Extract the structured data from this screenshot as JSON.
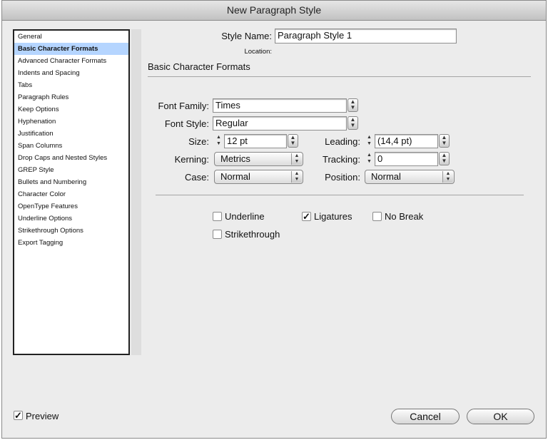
{
  "window": {
    "title": "New Paragraph Style"
  },
  "sidebar": {
    "items": [
      {
        "label": "General"
      },
      {
        "label": "Basic Character Formats"
      },
      {
        "label": "Advanced Character Formats"
      },
      {
        "label": "Indents and Spacing"
      },
      {
        "label": "Tabs"
      },
      {
        "label": "Paragraph Rules"
      },
      {
        "label": "Keep Options"
      },
      {
        "label": "Hyphenation"
      },
      {
        "label": "Justification"
      },
      {
        "label": "Span Columns"
      },
      {
        "label": "Drop Caps and Nested Styles"
      },
      {
        "label": "GREP Style"
      },
      {
        "label": "Bullets and Numbering"
      },
      {
        "label": "Character Color"
      },
      {
        "label": "OpenType Features"
      },
      {
        "label": "Underline Options"
      },
      {
        "label": "Strikethrough Options"
      },
      {
        "label": "Export Tagging"
      }
    ],
    "selected_index": 1
  },
  "header": {
    "style_name_label": "Style Name:",
    "style_name_value": "Paragraph Style 1",
    "location_label": "Location:",
    "section_title": "Basic Character Formats"
  },
  "form": {
    "font_family_label": "Font Family:",
    "font_family_value": "Times",
    "font_style_label": "Font Style:",
    "font_style_value": "Regular",
    "size_label": "Size:",
    "size_value": "12 pt",
    "leading_label": "Leading:",
    "leading_value": "(14,4 pt)",
    "kerning_label": "Kerning:",
    "kerning_value": "Metrics",
    "tracking_label": "Tracking:",
    "tracking_value": "0",
    "case_label": "Case:",
    "case_value": "Normal",
    "position_label": "Position:",
    "position_value": "Normal"
  },
  "options": {
    "underline": {
      "label": "Underline",
      "checked": false
    },
    "ligatures": {
      "label": "Ligatures",
      "checked": true
    },
    "no_break": {
      "label": "No Break",
      "checked": false
    },
    "strikethrough": {
      "label": "Strikethrough",
      "checked": false
    }
  },
  "footer": {
    "preview_label": "Preview",
    "preview_checked": true,
    "cancel_label": "Cancel",
    "ok_label": "OK"
  },
  "colors": {
    "selection": "#b5d5ff",
    "dialog_bg": "#ececec"
  }
}
